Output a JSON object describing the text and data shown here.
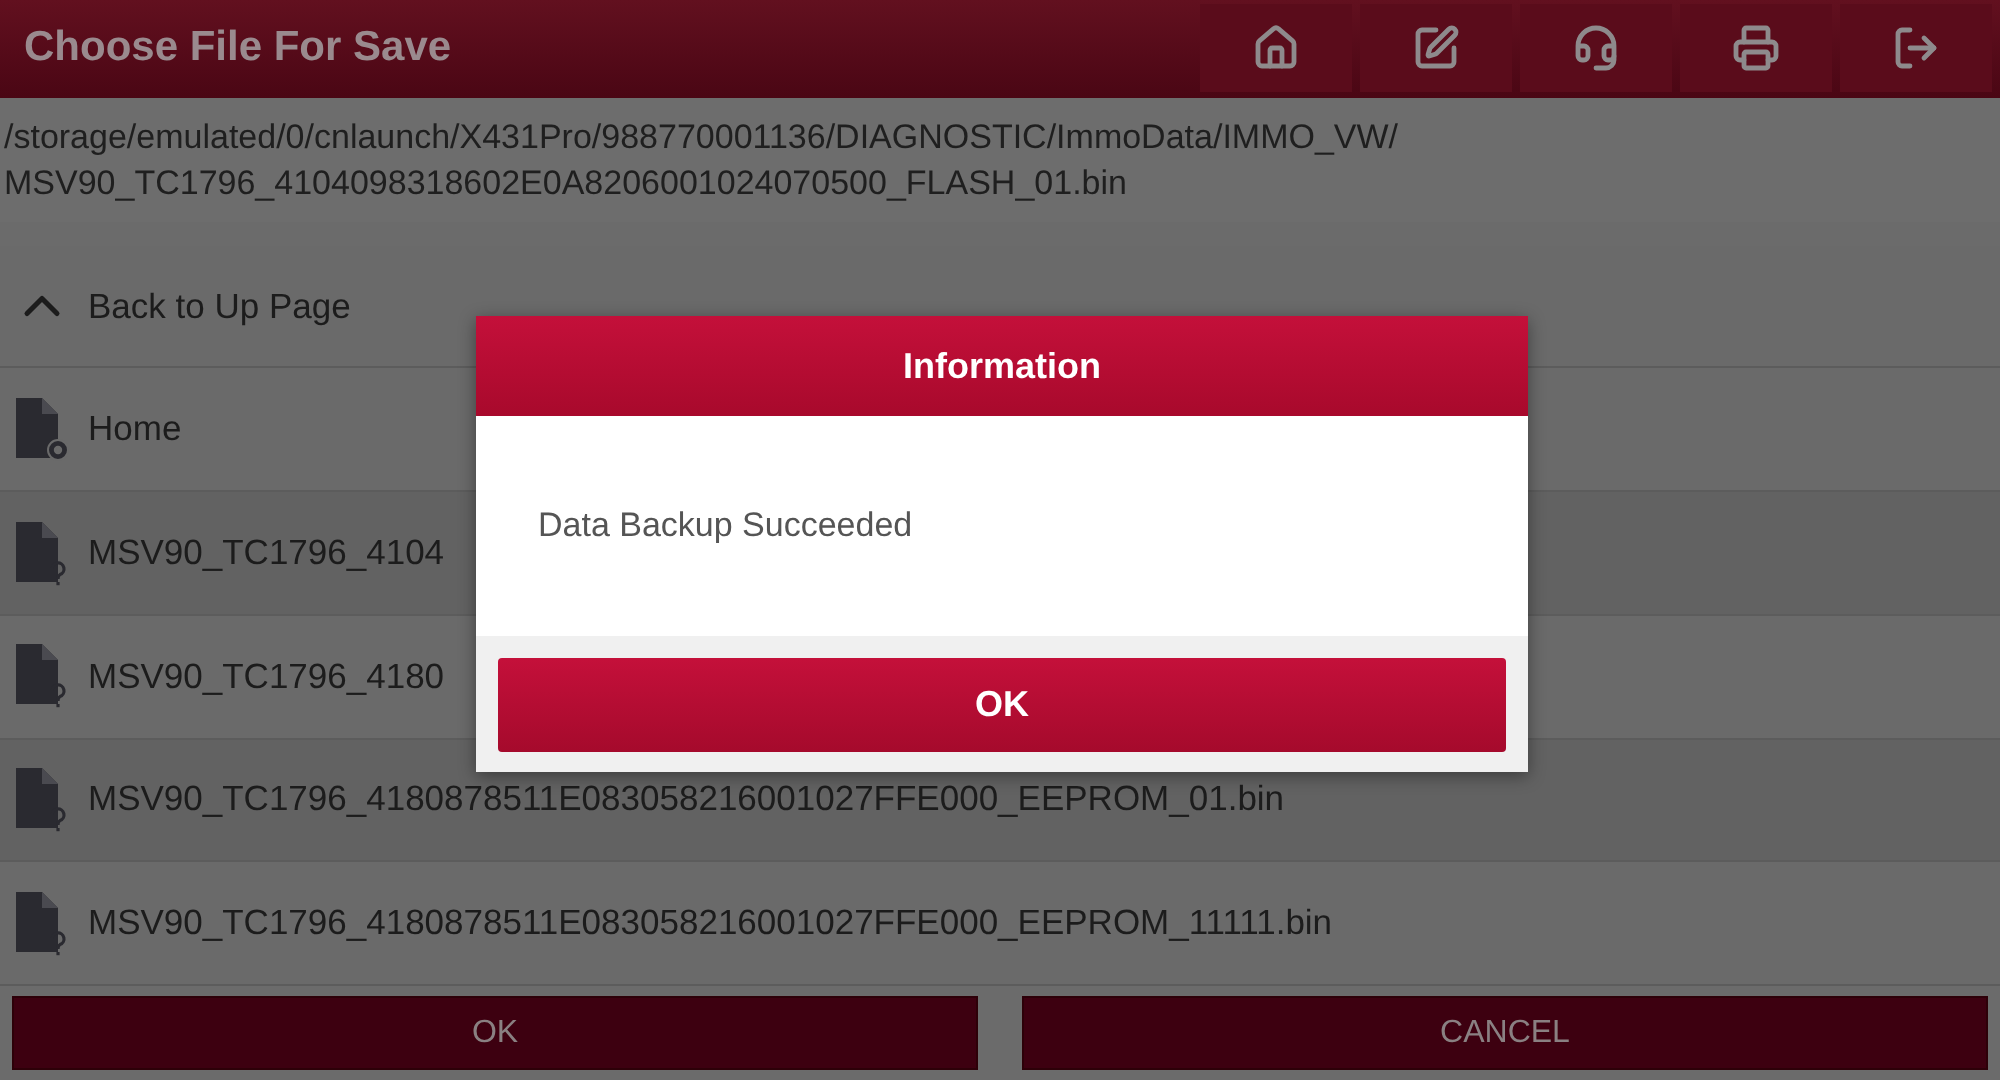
{
  "header": {
    "title": "Choose File For Save",
    "toolbar": [
      {
        "kind": "home"
      },
      {
        "kind": "edit"
      },
      {
        "kind": "support"
      },
      {
        "kind": "print"
      },
      {
        "kind": "exit"
      }
    ]
  },
  "path": [
    "/storage/emulated/0/cnlaunch/X431Pro/988770001136/DIAGNOSTIC/ImmoData/IMMO_VW/",
    "MSV90_TC1796_4104098318602E0A8206001024070500_FLASH_01.bin"
  ],
  "back": {
    "label": "Back to Up Page"
  },
  "files": [
    {
      "kind": "home",
      "name": "Home"
    },
    {
      "kind": "unknown",
      "name": "MSV90_TC1796_4104"
    },
    {
      "kind": "unknown",
      "name": "MSV90_TC1796_4180"
    },
    {
      "kind": "unknown",
      "name": "MSV90_TC1796_4180878511E083058216001027FFE000_EEPROM_01.bin"
    },
    {
      "kind": "unknown",
      "name": "MSV90_TC1796_4180878511E083058216001027FFE000_EEPROM_11111.bin"
    }
  ],
  "buttons": [
    "OK",
    "CANCEL"
  ],
  "dialog": {
    "title": "Information",
    "message": "Data Backup Succeeded",
    "button": "OK"
  }
}
